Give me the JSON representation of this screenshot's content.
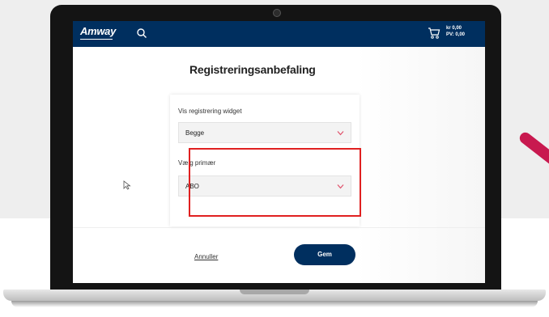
{
  "header": {
    "logo_text": "Amway",
    "cart_amount": "kr 0,00",
    "cart_pv": "PV: 0,00"
  },
  "page": {
    "title": "Registreringsanbefaling"
  },
  "form": {
    "widget_label": "Vis registrering widget",
    "widget_value": "Begge",
    "primary_label": "Vælg primær",
    "primary_value": "ABO"
  },
  "footer": {
    "cancel_label": "Annuller",
    "save_label": "Gem"
  },
  "colors": {
    "brand": "#002f5f",
    "highlight": "#e02020",
    "chevron": "#e0506a",
    "accent_stroke": "#c8194f"
  }
}
